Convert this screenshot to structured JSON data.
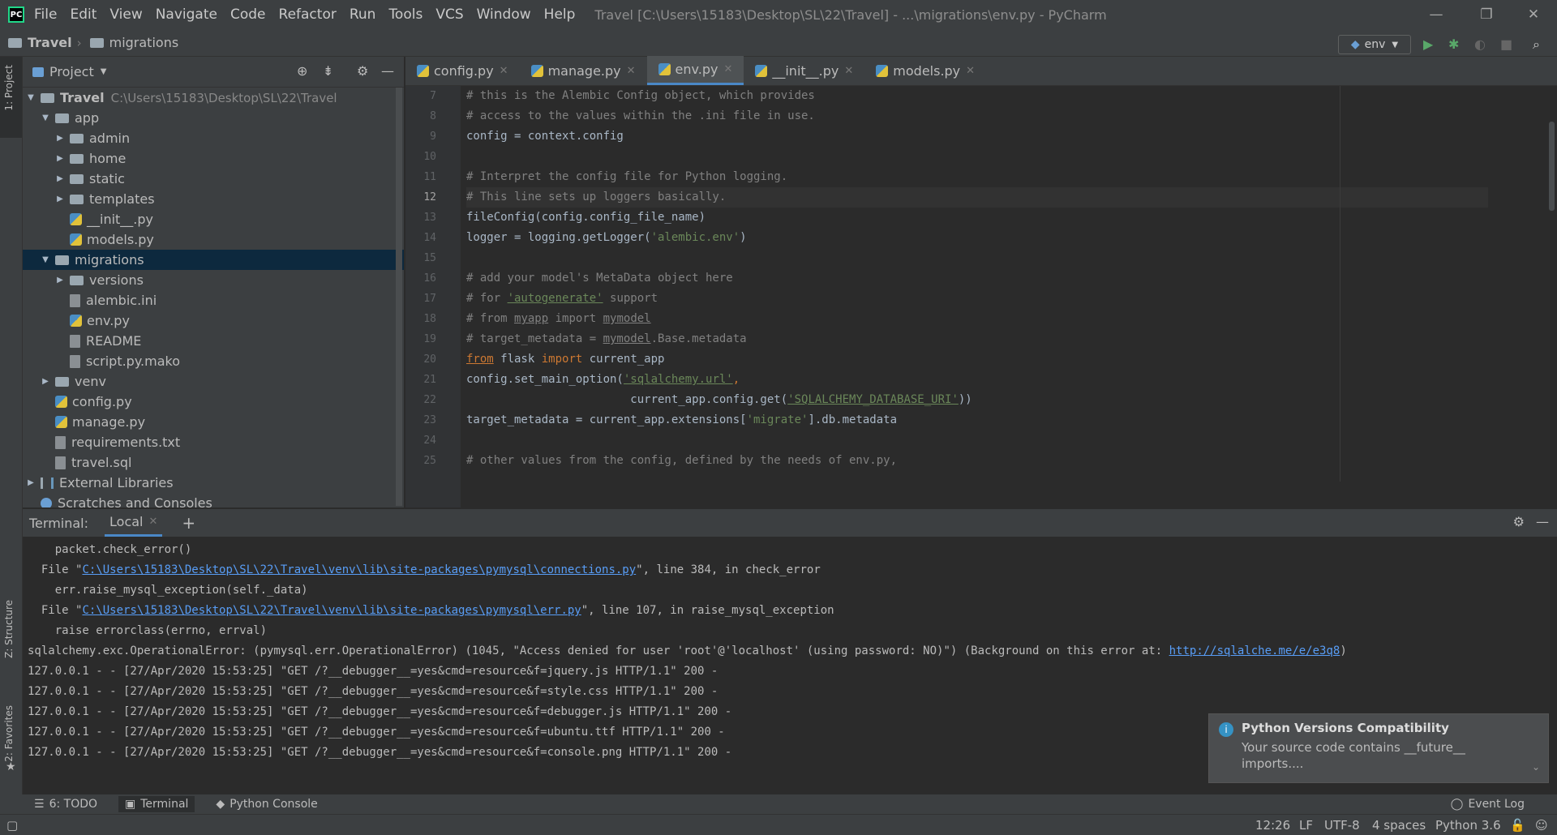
{
  "menu": [
    "File",
    "Edit",
    "View",
    "Navigate",
    "Code",
    "Refactor",
    "Run",
    "Tools",
    "VCS",
    "Window",
    "Help"
  ],
  "window_title": "Travel [C:\\Users\\15183\\Desktop\\SL\\22\\Travel] - ...\\migrations\\env.py - PyCharm",
  "breadcrumb": [
    "Travel",
    "migrations"
  ],
  "run_config": "env",
  "project_label": "Project",
  "tree": [
    {
      "label": "Travel",
      "extra": "C:\\Users\\15183\\Desktop\\SL\\22\\Travel"
    },
    {
      "label": "app"
    },
    {
      "label": "admin"
    },
    {
      "label": "home"
    },
    {
      "label": "static"
    },
    {
      "label": "templates"
    },
    {
      "label": "__init__.py"
    },
    {
      "label": "models.py"
    },
    {
      "label": "migrations"
    },
    {
      "label": "versions"
    },
    {
      "label": "alembic.ini"
    },
    {
      "label": "env.py"
    },
    {
      "label": "README"
    },
    {
      "label": "script.py.mako"
    },
    {
      "label": "venv"
    },
    {
      "label": "config.py"
    },
    {
      "label": "manage.py"
    },
    {
      "label": "requirements.txt"
    },
    {
      "label": "travel.sql"
    },
    {
      "label": "External Libraries"
    },
    {
      "label": "Scratches and Consoles"
    }
  ],
  "tabs": [
    "config.py",
    "manage.py",
    "env.py",
    "__init__.py",
    "models.py"
  ],
  "line_numbers": [
    "7",
    "8",
    "9",
    "10",
    "11",
    "12",
    "13",
    "14",
    "15",
    "16",
    "17",
    "18",
    "19",
    "20",
    "21",
    "22",
    "23",
    "24",
    "25"
  ],
  "code": [
    "# this is the Alembic Config object, which provides",
    "# access to the values within the .ini file in use.",
    "config = context.config",
    "",
    "# Interpret the config file for Python logging.",
    "# This line sets up loggers basically.",
    "fileConfig(config.config_file_name)",
    "logger = logging.getLogger(",
    "'alembic.env'",
    ")",
    "# add your model's MetaData object here",
    "# for ",
    "'autogenerate'",
    " support",
    "# from ",
    "myapp",
    " import ",
    "mymodel",
    "# target_metadata = ",
    "mymodel",
    ".Base.metadata",
    "from",
    " flask ",
    "import",
    " current_app",
    "config.set_main_option(",
    "'sqlalchemy.url'",
    ",",
    "                        current_app.config.get(",
    "'SQLALCHEMY_DATABASE_URI'",
    "))",
    "target_metadata = current_app.extensions[",
    "'migrate'",
    "].db.metadata",
    "# other values from the config, defined by the needs of env.py,"
  ],
  "terminal": {
    "label": "Terminal:",
    "tab": "Local",
    "lines": [
      "    packet.check_error()",
      "  File \"",
      "C:\\Users\\15183\\Desktop\\SL\\22\\Travel\\venv\\lib\\site-packages\\pymysql\\connections.py",
      "\", line 384, in check_error",
      "    err.raise_mysql_exception(self._data)",
      "  File \"",
      "C:\\Users\\15183\\Desktop\\SL\\22\\Travel\\venv\\lib\\site-packages\\pymysql\\err.py",
      "\", line 107, in raise_mysql_exception",
      "    raise errorclass(errno, errval)",
      "sqlalchemy.exc.OperationalError: (pymysql.err.OperationalError) (1045, \"Access denied for user 'root'@'localhost' (using password: NO)\") (Background on this error at: ",
      "http://sqlalche.me/e/e3q8",
      ")",
      "127.0.0.1 - - [27/Apr/2020 15:53:25] \"GET /?__debugger__=yes&cmd=resource&f=jquery.js HTTP/1.1\" 200 -",
      "127.0.0.1 - - [27/Apr/2020 15:53:25] \"GET /?__debugger__=yes&cmd=resource&f=style.css HTTP/1.1\" 200 -",
      "127.0.0.1 - - [27/Apr/2020 15:53:25] \"GET /?__debugger__=yes&cmd=resource&f=debugger.js HTTP/1.1\" 200 -",
      "127.0.0.1 - - [27/Apr/2020 15:53:25] \"GET /?__debugger__=yes&cmd=resource&f=ubuntu.ttf HTTP/1.1\" 200 -",
      "127.0.0.1 - - [27/Apr/2020 15:53:25] \"GET /?__debugger__=yes&cmd=resource&f=console.png HTTP/1.1\" 200 -"
    ]
  },
  "notification": {
    "title": "Python Versions Compatibility",
    "body1": "Your source code contains __future__",
    "body2": "imports...."
  },
  "side_tabs": {
    "project": "1: Project",
    "structure": "Z: Structure",
    "favorites": "2: Favorites"
  },
  "bottom_tabs": [
    "6: TODO",
    "Terminal",
    "Python Console"
  ],
  "event_log": "Event Log",
  "status": {
    "pos": "12:26",
    "eol": "LF",
    "enc": "UTF-8",
    "indent": "4 spaces",
    "interp": "Python 3.6"
  }
}
